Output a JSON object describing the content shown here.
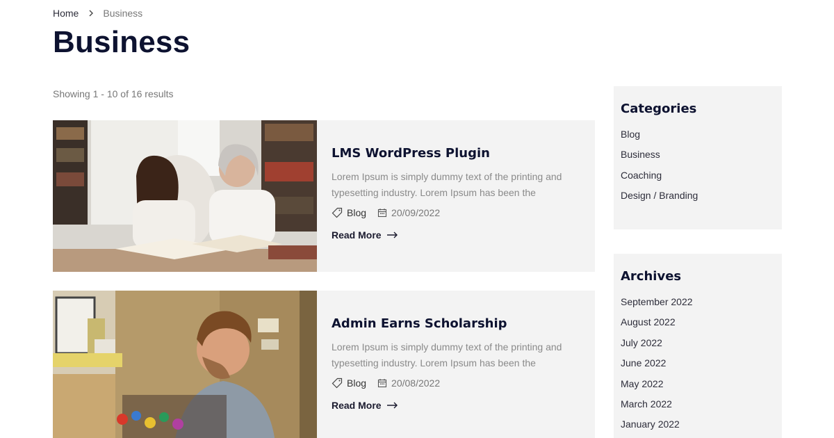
{
  "breadcrumb": {
    "home": "Home",
    "current": "Business"
  },
  "page_title": "Business",
  "results_text": "Showing 1 - 10 of 16 results",
  "posts": [
    {
      "title": "LMS WordPress Plugin",
      "excerpt": "Lorem Ipsum is simply dummy text of the printing and typesetting industry. Lorem Ipsum has been the industry'...",
      "category": "Blog",
      "date": "20/09/2022",
      "read_more": "Read More",
      "image_icon": "students-studying-photo"
    },
    {
      "title": "Admin Earns Scholarship",
      "excerpt": "Lorem Ipsum is simply dummy text of the printing and typesetting industry. Lorem Ipsum has been the industry'...",
      "category": "Blog",
      "date": "20/08/2022",
      "read_more": "Read More",
      "image_icon": "man-working-photo"
    }
  ],
  "sidebar": {
    "categories": {
      "title": "Categories",
      "items": [
        "Blog",
        "Business",
        "Coaching",
        "Design / Branding"
      ]
    },
    "archives": {
      "title": "Archives",
      "items": [
        "September 2022",
        "August 2022",
        "July 2022",
        "June 2022",
        "May 2022",
        "March 2022",
        "January 2022"
      ]
    }
  },
  "colors": {
    "heading": "#0d1230",
    "card_bg": "#f3f3f3",
    "muted_text": "#8a8a8a"
  }
}
